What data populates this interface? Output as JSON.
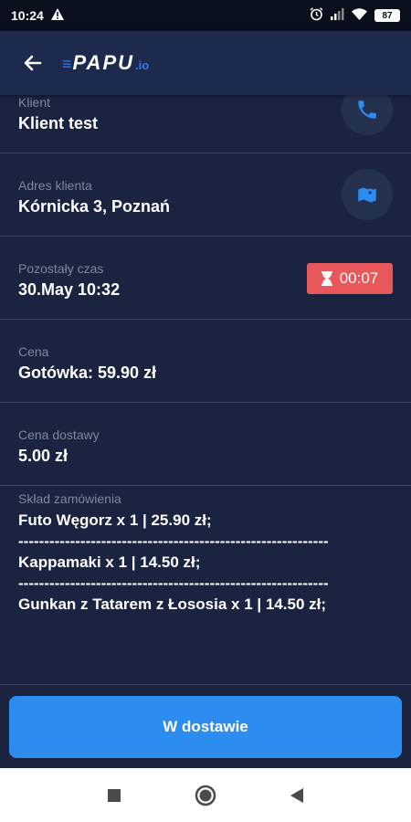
{
  "status_bar": {
    "time": "10:24",
    "battery": "87"
  },
  "app": {
    "logo_dash": "≡",
    "logo_main": "PAPU",
    "logo_suffix": ".io"
  },
  "fields": [
    {
      "label": "Klient",
      "value": "Klient test",
      "action_icon": "phone-icon"
    },
    {
      "label": "Adres klienta",
      "value": "Kórnicka 3, Poznań",
      "action_icon": "map-icon"
    },
    {
      "label": "Pozostały czas",
      "value": "30.May 10:32",
      "timer": "00:07"
    },
    {
      "label": "Cena",
      "value": "Gotówka: 59.90 zł"
    },
    {
      "label": "Cena dostawy",
      "value": "5.00 zł"
    }
  ],
  "order": {
    "label": "Skład zamówienia",
    "items": [
      "Futo Węgorz x 1 | 25.90 zł;",
      "Kappamaki x 1 | 14.50 zł;",
      "Gunkan z Tatarem z Łososia x 1 | 14.50 zł;"
    ],
    "separator": "------------------------------------------------------------"
  },
  "action_button": {
    "label": "W dostawie"
  },
  "colors": {
    "background": "#1a2340",
    "accent": "#2d8cf0",
    "timer": "#e8585a"
  }
}
